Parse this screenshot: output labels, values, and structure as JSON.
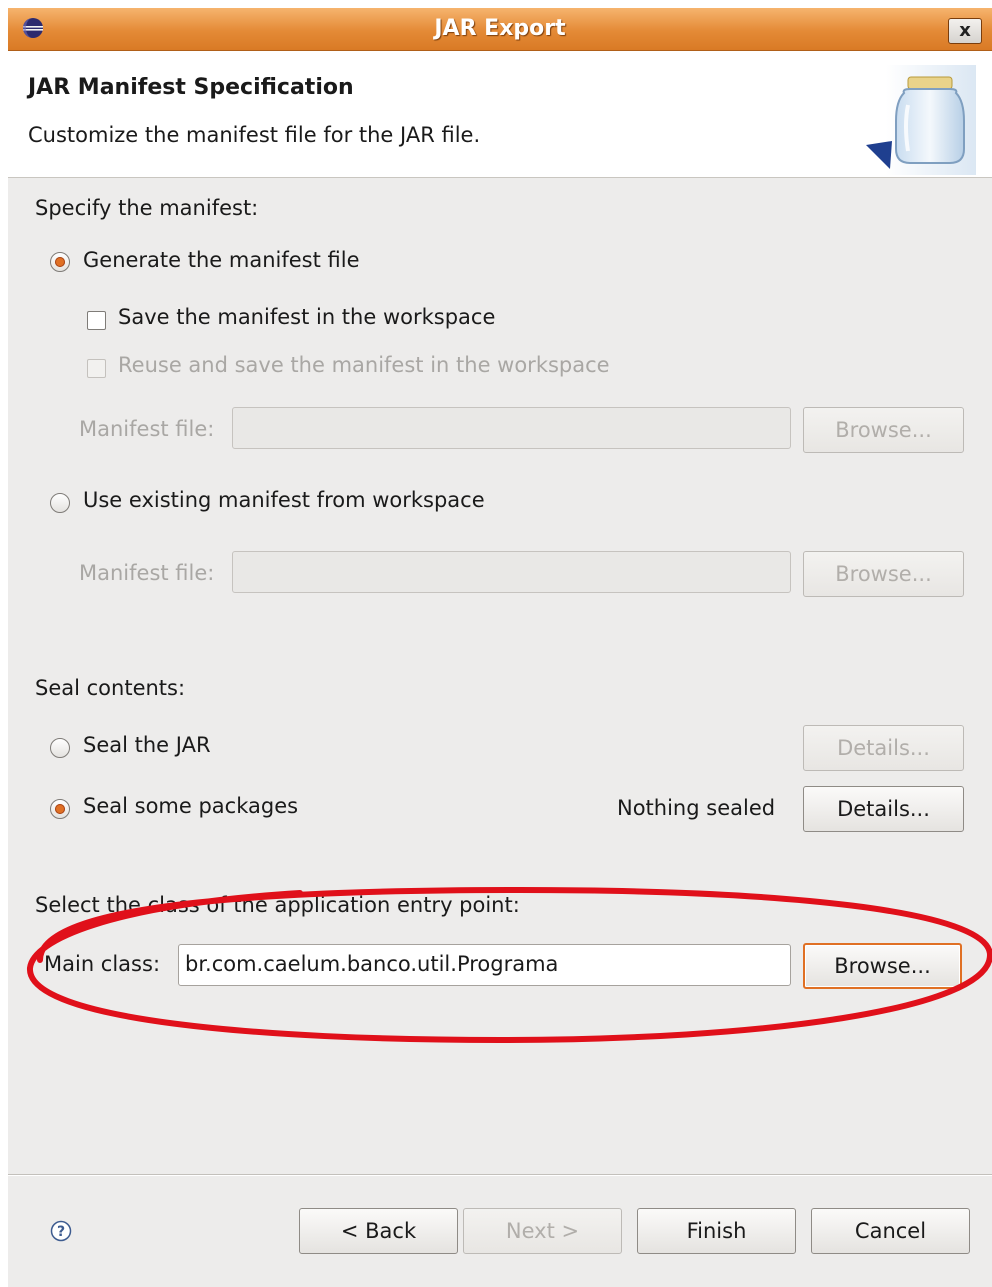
{
  "window": {
    "title": "JAR Export",
    "close_label": "x"
  },
  "banner": {
    "heading": "JAR Manifest Specification",
    "subtitle": "Customize the manifest file for the JAR file."
  },
  "manifest": {
    "section_label": "Specify the manifest:",
    "generate_option": {
      "label": "Generate the manifest file",
      "selected": true
    },
    "save_checkbox": {
      "label": "Save the manifest in the workspace",
      "checked": false
    },
    "reuse_checkbox": {
      "label": "Reuse and save the manifest in the workspace",
      "checked": false,
      "enabled": false
    },
    "generate_file_label": "Manifest file:",
    "generate_file_value": "",
    "generate_browse_label": "Browse...",
    "existing_option": {
      "label": "Use existing manifest from workspace",
      "selected": false
    },
    "existing_file_label": "Manifest file:",
    "existing_file_value": "",
    "existing_browse_label": "Browse..."
  },
  "seal": {
    "section_label": "Seal contents:",
    "seal_jar": {
      "label": "Seal the JAR",
      "selected": false,
      "details_label": "Details..."
    },
    "seal_packages": {
      "label": "Seal some packages",
      "selected": true,
      "status": "Nothing sealed",
      "details_label": "Details..."
    }
  },
  "entry_point": {
    "section_label": "Select the class of the application entry point:",
    "main_class_label": "Main class:",
    "main_class_value": "br.com.caelum.banco.util.Programa",
    "browse_label": "Browse..."
  },
  "footer": {
    "back_label": "< Back",
    "next_label": "Next >",
    "finish_label": "Finish",
    "cancel_label": "Cancel"
  },
  "colors": {
    "title_bar": "#e48a36",
    "accent": "#e07024",
    "annotation": "#e0101a",
    "dialog_bg": "#edeceb"
  },
  "icons": [
    "eclipse-icon",
    "close-icon",
    "jar-icon",
    "help-icon"
  ]
}
